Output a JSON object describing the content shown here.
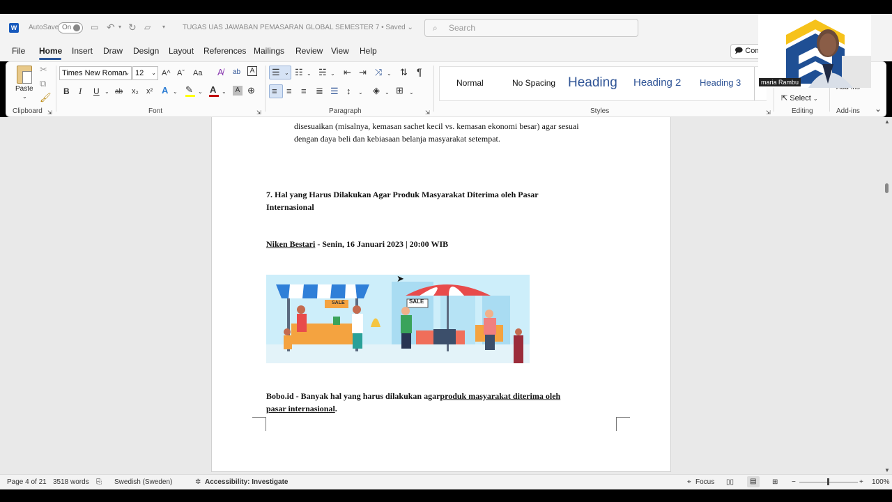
{
  "titlebar": {
    "autosave_label": "AutoSave",
    "autosave_state": "On",
    "doc_title": "TUGAS UAS JAWABAN PEMASARAN GLOBAL SEMESTER 7",
    "save_status": "Saved",
    "search_placeholder": "Search"
  },
  "menu": [
    "File",
    "Home",
    "Insert",
    "Draw",
    "Design",
    "Layout",
    "References",
    "Mailings",
    "Review",
    "View",
    "Help"
  ],
  "comments_label": "Com",
  "ribbon": {
    "paste_label": "Paste",
    "clipboard_label": "Clipboard",
    "font_name": "Times New Roman",
    "font_size": "12",
    "font_label": "Font",
    "paragraph_label": "Paragraph",
    "styles": [
      "Normal",
      "No Spacing",
      "Heading",
      "Heading 2",
      "Heading 3"
    ],
    "styles_label": "Styles",
    "select_label": "Select",
    "editing_label": "Editing",
    "addins_label": "Add-ins",
    "addins_button": "Add-ins",
    "bold": "B",
    "italic": "I",
    "underline": "U",
    "strike": "ab",
    "sub": "x₂",
    "sup": "x²",
    "grow": "A^",
    "shrink": "Aˇ",
    "case": "Aa",
    "pilcrow": "¶"
  },
  "document": {
    "line1": "disesuaikan (misalnya, kemasan sachet kecil vs. kemasan ekonomi besar) agar sesuai",
    "line2": "dengan daya beli dan kebiasaan belanja masyarakat setempat.",
    "heading_line1": "7. Hal yang Harus Dilakukan Agar Produk Masyarakat Diterima oleh Pasar",
    "heading_line2": "Internasional",
    "author": "Niken Bestari",
    "date_line": " - Senin, 16 Januari 2023 | 20:00 WIB",
    "image_sale_1": "SALE",
    "image_sale_2": "SALE",
    "para_start": "Bobo.id - Banyak hal yang harus dilakukan agar",
    "para_link1": "produk masyarakat diterima oleh",
    "para_link2": "pasar internasional",
    "para_end": "."
  },
  "status": {
    "page": "Page 4 of 21",
    "words": "3518 words",
    "language": "Swedish (Sweden)",
    "accessibility": "Accessibility: Investigate",
    "focus": "Focus",
    "zoom": "100%"
  },
  "webcam": {
    "name": "maria Rambu"
  },
  "colors": {
    "accent": "#2b579a",
    "heading_blue": "#2f5496",
    "word_blue": "#185abd"
  }
}
